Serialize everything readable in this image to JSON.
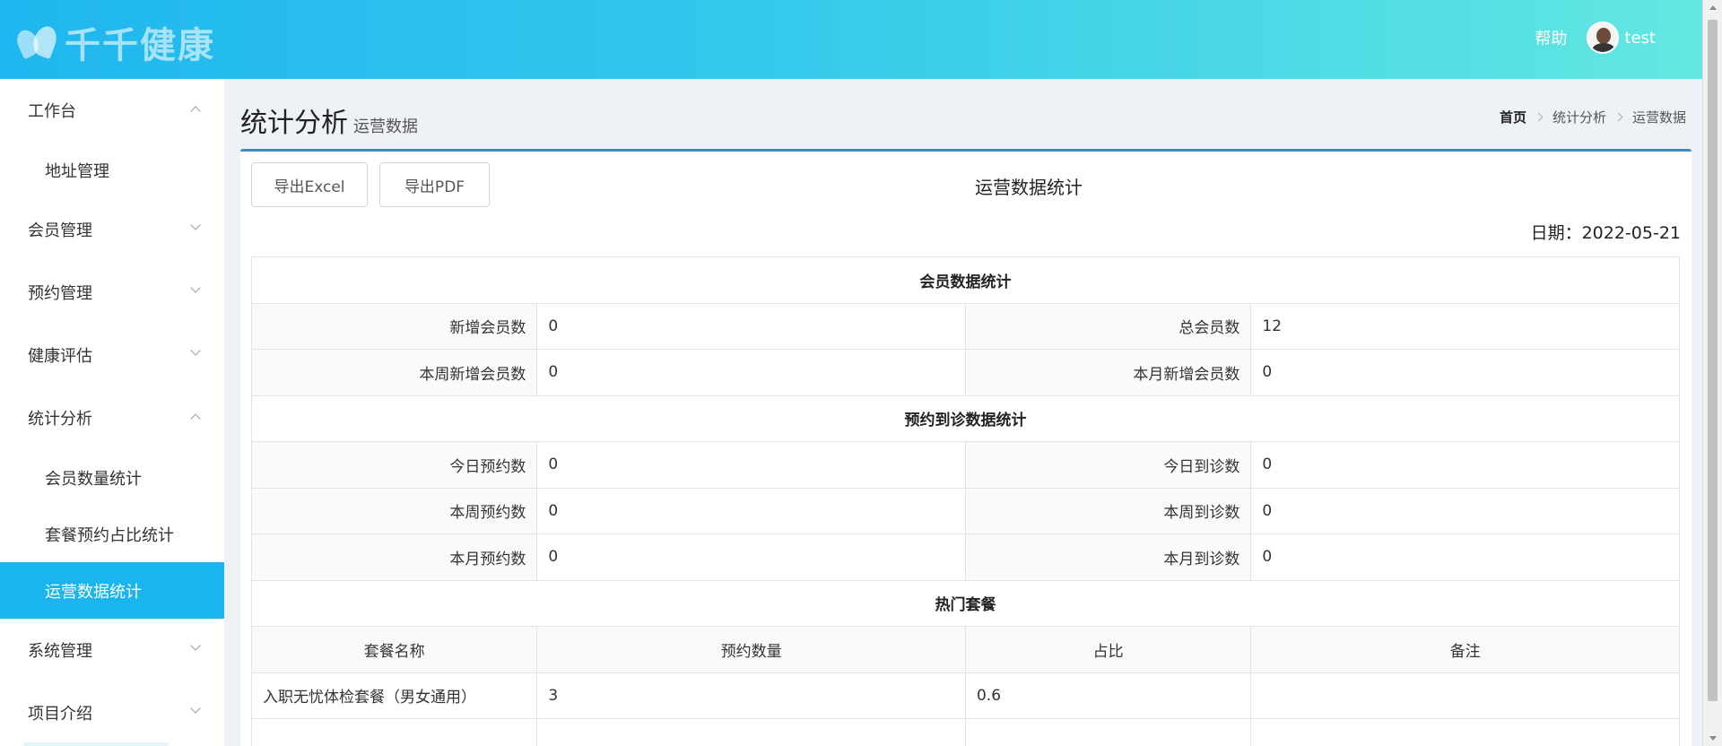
{
  "header": {
    "logo_text": "千千健康",
    "help": "帮助",
    "user_name": "test"
  },
  "sidebar": {
    "items": [
      {
        "label": "工作台",
        "expanded": true,
        "children": [
          {
            "label": "地址管理"
          }
        ]
      },
      {
        "label": "会员管理",
        "expanded": false
      },
      {
        "label": "预约管理",
        "expanded": false
      },
      {
        "label": "健康评估",
        "expanded": false
      },
      {
        "label": "统计分析",
        "expanded": true,
        "children": [
          {
            "label": "会员数量统计"
          },
          {
            "label": "套餐预约占比统计"
          },
          {
            "label": "运营数据统计",
            "active": true
          }
        ]
      },
      {
        "label": "系统管理",
        "expanded": false
      },
      {
        "label": "项目介绍",
        "expanded": false
      }
    ]
  },
  "page": {
    "title": "统计分析",
    "subtitle": "运营数据",
    "breadcrumb": [
      "首页",
      "统计分析",
      "运营数据"
    ]
  },
  "panel": {
    "export_excel": "导出Excel",
    "export_pdf": "导出PDF",
    "report_title": "运营数据统计",
    "date_label": "日期：2022-05-21"
  },
  "report": {
    "member_section": "会员数据统计",
    "new_members_label": "新增会员数",
    "new_members": "0",
    "total_members_label": "总会员数",
    "total_members": "12",
    "week_new_members_label": "本周新增会员数",
    "week_new_members": "0",
    "month_new_members_label": "本月新增会员数",
    "month_new_members": "0",
    "visit_section": "预约到诊数据统计",
    "today_order_label": "今日预约数",
    "today_order": "0",
    "today_visit_label": "今日到诊数",
    "today_visit": "0",
    "week_order_label": "本周预约数",
    "week_order": "0",
    "week_visit_label": "本周到诊数",
    "week_visit": "0",
    "month_order_label": "本月预约数",
    "month_order": "0",
    "month_visit_label": "本月到诊数",
    "month_visit": "0",
    "hot_section": "热门套餐",
    "hot_columns": [
      "套餐名称",
      "预约数量",
      "占比",
      "备注"
    ],
    "hot_rows": [
      {
        "name": "入职无忧体检套餐（男女通用）",
        "count": "3",
        "ratio": "0.6",
        "remark": ""
      },
      {
        "name": "",
        "count": "",
        "ratio": "",
        "remark": ""
      }
    ]
  },
  "colors": {
    "header_gradient_start": "#1fb6ef",
    "header_gradient_end": "#63e8e1",
    "active_menu": "#1ab5ee",
    "panel_border": "#3c8dbc"
  }
}
